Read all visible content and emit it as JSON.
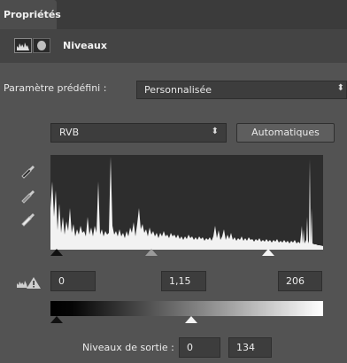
{
  "panel": {
    "tab_label": "Propriétés"
  },
  "header": {
    "title": "Niveaux",
    "adjustment_icon": "levels-histogram-icon",
    "mask_icon": "layer-mask-icon"
  },
  "preset": {
    "label": "Paramètre prédéfini :",
    "value": "Personnalisée",
    "arrow_icon": "updown-arrows-icon"
  },
  "channel": {
    "value": "RVB",
    "arrow_icon": "updown-arrows-icon"
  },
  "auto_button": {
    "label": "Automatiques"
  },
  "pickers": [
    "black-eyedropper-icon",
    "gray-eyedropper-icon",
    "white-eyedropper-icon"
  ],
  "input_levels": {
    "black": "0",
    "gamma": "1,15",
    "white": "206"
  },
  "output_levels": {
    "label": "Niveaux de sortie :",
    "black": "0",
    "white": "134"
  },
  "colors": {
    "panel_bg": "#535353",
    "field_bg": "#3d3d3d",
    "histogram_bg": "#2d2d2d"
  }
}
